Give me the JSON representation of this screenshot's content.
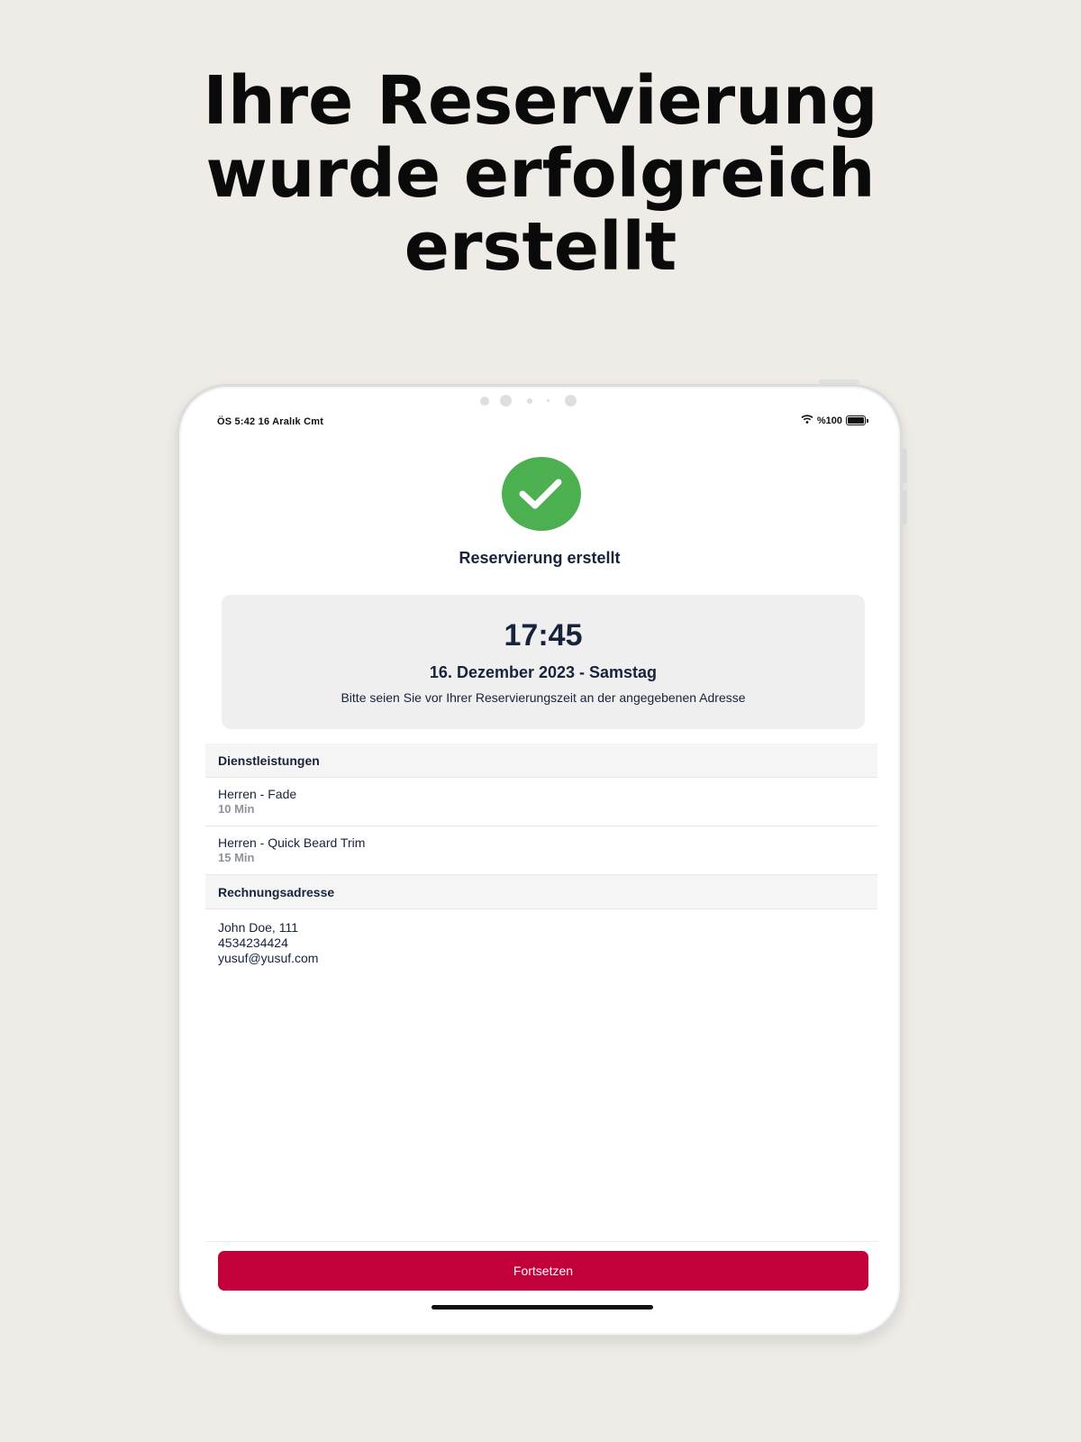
{
  "headline": {
    "line1": "Ihre Reservierung",
    "line2": "wurde erfolgreich",
    "line3": "erstellt"
  },
  "status_bar": {
    "time_date": "ÖS 5:42   16 Aralık Cmt",
    "battery": "%100",
    "wifi_icon": "wifi-icon",
    "battery_icon": "battery-icon"
  },
  "confirmation": {
    "icon": "checkmark-icon",
    "icon_color": "#4caf50",
    "title": "Reservierung erstellt"
  },
  "appointment": {
    "time": "17:45",
    "date": "16. Dezember 2023 - Samstag",
    "hint": "Bitte seien Sie vor Ihrer Reservierungszeit an der angegebenen Adresse"
  },
  "services": {
    "header": "Dienstleistungen",
    "items": [
      {
        "name": "Herren - Fade",
        "duration": "10 Min"
      },
      {
        "name": "Herren - Quick Beard Trim",
        "duration": "15 Min"
      }
    ]
  },
  "billing": {
    "header": "Rechnungsadresse",
    "name": "John Doe, 111",
    "phone": "4534234424",
    "email": "yusuf@yusuf.com"
  },
  "actions": {
    "continue_label": "Fortsetzen",
    "continue_color": "#c2003a"
  }
}
